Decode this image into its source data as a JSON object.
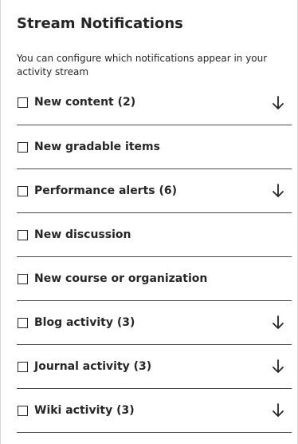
{
  "panel": {
    "title": "Stream Notifications",
    "description": "You can configure which notifications appear in your activity stream"
  },
  "items": [
    {
      "label": "New content (2)",
      "checked": false,
      "expandable": true,
      "icon": "arrow-down-icon"
    },
    {
      "label": "New gradable items",
      "checked": false,
      "expandable": false
    },
    {
      "label": "Performance alerts (6)",
      "checked": false,
      "expandable": true,
      "icon": "arrow-down-icon"
    },
    {
      "label": "New discussion",
      "checked": false,
      "expandable": false
    },
    {
      "label": "New course or organization",
      "checked": false,
      "expandable": false
    },
    {
      "label": "Blog activity (3)",
      "checked": false,
      "expandable": true,
      "icon": "arrow-down-icon"
    },
    {
      "label": "Journal activity (3)",
      "checked": false,
      "expandable": true,
      "icon": "arrow-down-icon"
    },
    {
      "label": "Wiki activity (3)",
      "checked": false,
      "expandable": true,
      "icon": "arrow-down-icon"
    }
  ],
  "colors": {
    "text": "#262626",
    "divider": "#4a4a4a",
    "panel_border": "#d9d9d9"
  }
}
